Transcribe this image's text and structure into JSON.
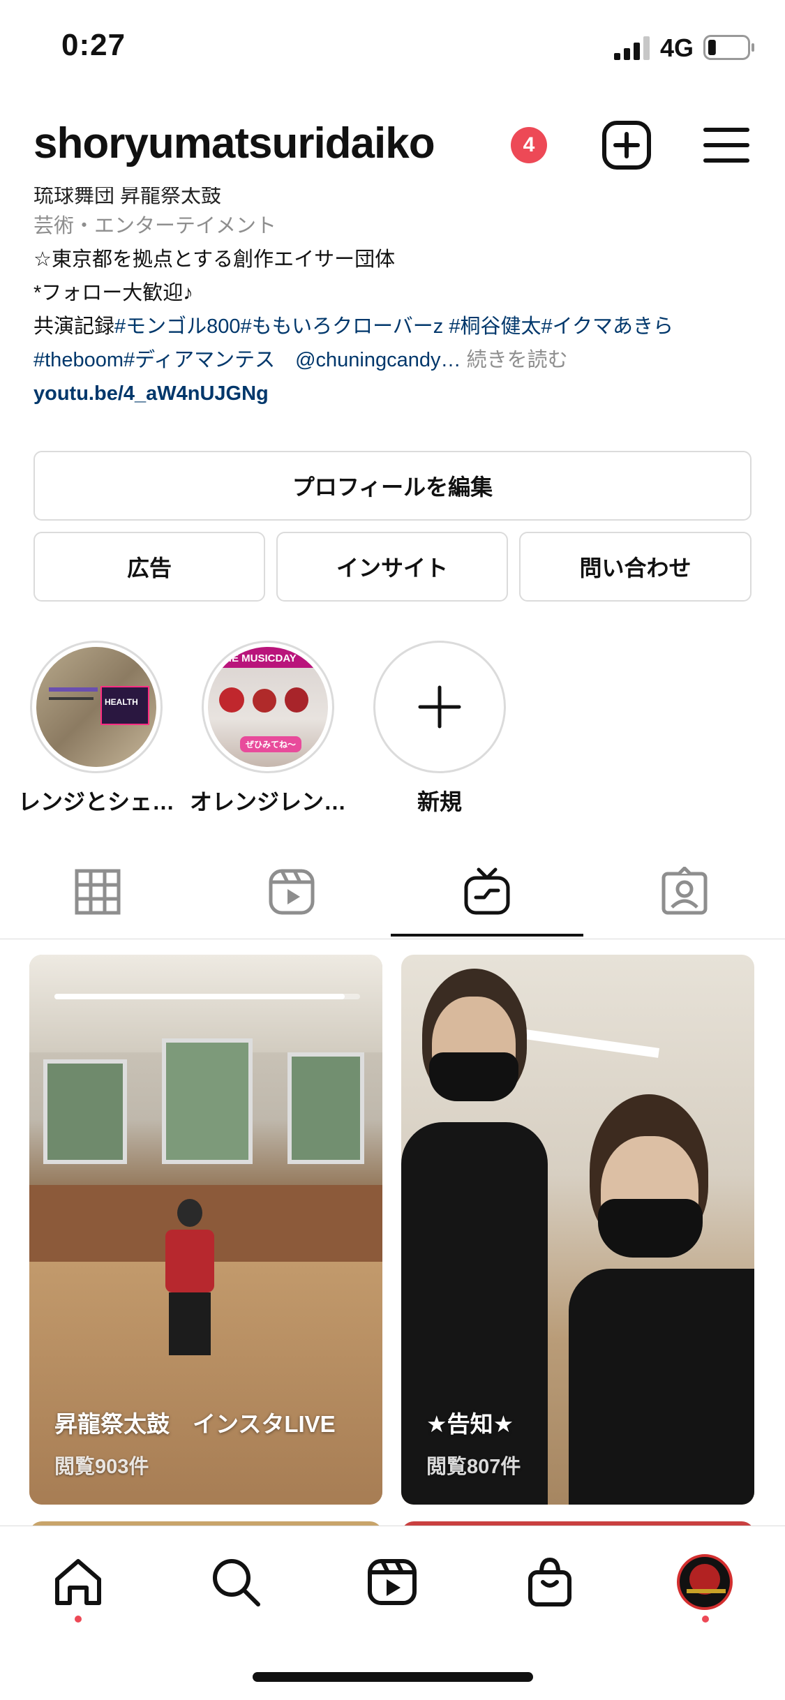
{
  "status_bar": {
    "time": "0:27",
    "network": "4G",
    "battery_level": 0.2
  },
  "header": {
    "username": "shoryumatsuridaiko",
    "notification_count": "4"
  },
  "bio": {
    "name_partial": "琉球舞団 昇龍祭太鼓",
    "category": "芸術・エンターテイメント",
    "line1": "☆東京都を拠点とする創作エイサー団体",
    "line2": "*フォロー大歓迎♪",
    "line3_prefix": "共演記録",
    "line3_tags": "#モンゴル800#ももいろクローバーz #桐谷健太#イクマあきら",
    "line4_tags": "#theboom#ディアマンテス　@chuningcandy…",
    "more": "続きを読む",
    "link": "youtu.be/4_aW4nUJGNg"
  },
  "buttons": {
    "edit_profile": "プロフィールを編集",
    "ads": "広告",
    "insights": "インサイト",
    "contact": "問い合わせ"
  },
  "highlights": [
    {
      "label": "レンジとシェ…",
      "thumb_text": "HEALTH"
    },
    {
      "label": "オレンジレン…",
      "thumb_text": "THE MUSICDAY",
      "thumb_caption": "ぜひみてね〜"
    },
    {
      "label": "新規"
    }
  ],
  "tabs": [
    "grid",
    "reels",
    "igtv",
    "tagged"
  ],
  "active_tab": "igtv",
  "videos": [
    {
      "title": "昇龍祭太鼓　インスタLIVE",
      "views": "閲覧903件",
      "progress": 0.95
    },
    {
      "title": "★告知★",
      "views": "閲覧807件"
    }
  ],
  "bottom_nav": [
    "home",
    "search",
    "reels",
    "shop",
    "profile"
  ],
  "colors": {
    "link": "#00376b",
    "badge": "#ed4956",
    "muted": "#8e8e8e",
    "border": "#dbdbdb"
  }
}
